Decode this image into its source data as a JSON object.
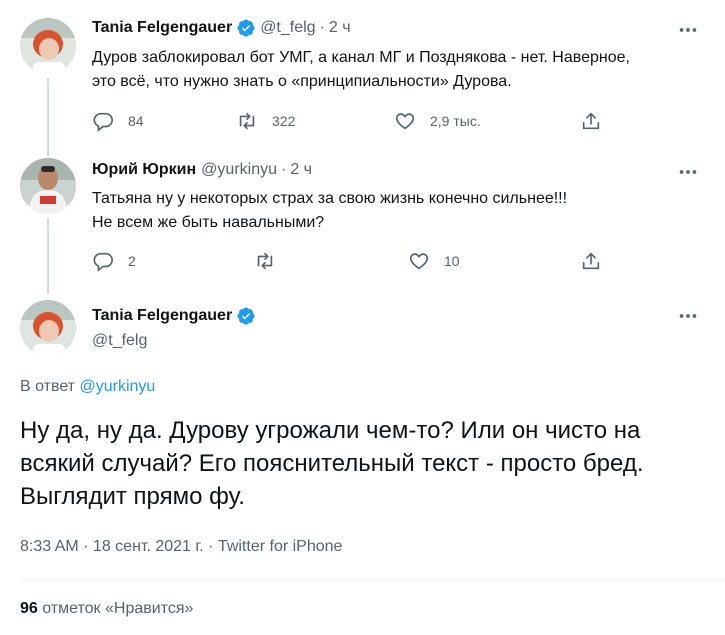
{
  "tweet1": {
    "display_name": "Tania Felgengauer",
    "handle": "@t_felg",
    "time": "2 ч",
    "text_line1": "Дуров заблокировал бот УМГ, а канал МГ и Позднякова - нет. Наверное,",
    "text_line2": "это всё, что нужно знать о «принципиальности» Дурова.",
    "replies": "84",
    "retweets": "322",
    "likes": "2,9 тыс."
  },
  "tweet2": {
    "display_name": "Юрий Юркин",
    "handle": "@yurkinyu",
    "time": "2 ч",
    "text_line1": "Татьяна ну у некоторых страх за свою жизнь конечно сильнее!!!",
    "text_line2": "Не всем же быть навальными?",
    "replies": "2",
    "retweets": "",
    "likes": "10"
  },
  "main_tweet": {
    "display_name": "Tania Felgengauer",
    "handle": "@t_felg",
    "reply_prefix": "В ответ",
    "reply_mention": "@yurkinyu",
    "text": "Ну да, ну да. Дурову угрожали чем-то? Или он чисто на всякий случай? Его пояснительный текст - просто бред. Выглядит прямо фу.",
    "timestamp": "8:33 AM · 18 сент. 2021 г. · Twitter for iPhone",
    "like_count": "96",
    "like_label": "отметок «Нравится»"
  },
  "colors": {
    "accent": "#1d9bf0",
    "text_primary": "#0f1419",
    "text_secondary": "#536471",
    "thread_line": "#cfd9de"
  }
}
